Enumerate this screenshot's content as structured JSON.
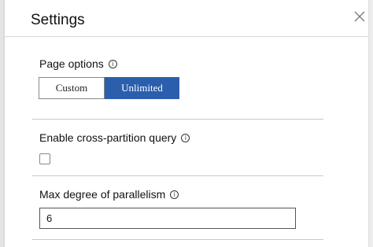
{
  "panel": {
    "title": "Settings",
    "close_icon": "close-icon"
  },
  "page_options": {
    "label": "Page options",
    "info_icon": "info-icon",
    "options": [
      "Custom",
      "Unlimited"
    ],
    "selected": "Unlimited"
  },
  "cross_partition": {
    "label": "Enable cross-partition query",
    "info_icon": "info-icon",
    "checked": false
  },
  "parallelism": {
    "label": "Max degree of parallelism",
    "info_icon": "info-icon",
    "value": "6"
  },
  "colors": {
    "accent": "#2b5fad",
    "panel_bg": "#ffffff"
  }
}
